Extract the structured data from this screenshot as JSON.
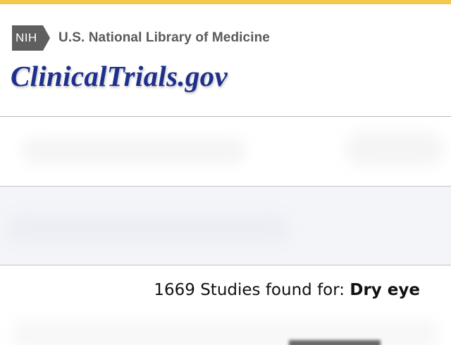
{
  "header": {
    "nih_badge": "NIH",
    "library_name": "U.S. National Library of Medicine",
    "site_logo": "ClinicalTrials.gov"
  },
  "results": {
    "count_text": "1669 Studies found for:",
    "search_term": "Dry eye"
  },
  "colors": {
    "top_bar": "#f2c94c",
    "nih_badge": "#5f5f5f",
    "site_logo": "#1f2f8c",
    "band_background": "#f4f5f9"
  }
}
